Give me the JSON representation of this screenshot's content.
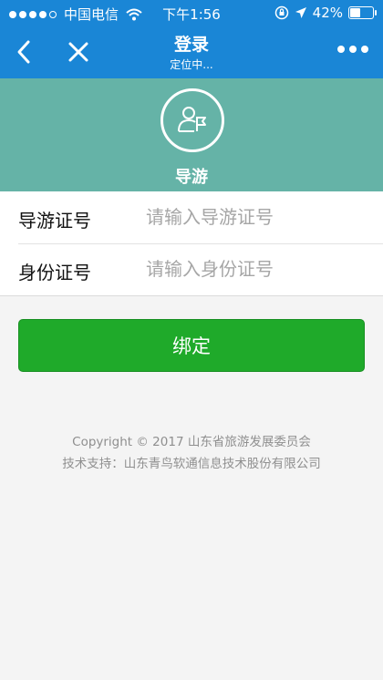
{
  "status": {
    "carrier": "中国电信",
    "time": "下午1:56",
    "battery": "42%",
    "battery_level": 0.42
  },
  "nav": {
    "title": "登录",
    "subtitle": "定位中...",
    "icons": [
      "chevron-left-icon",
      "close-icon",
      "more-dots-icon"
    ]
  },
  "profile": {
    "role_label": "导游",
    "icon": "user-flag-icon"
  },
  "form": {
    "fields": [
      {
        "label": "导游证号",
        "placeholder": "请输入导游证号",
        "value": ""
      },
      {
        "label": "身份证号",
        "placeholder": "请输入身份证号",
        "value": ""
      }
    ]
  },
  "actions": {
    "bind_label": "绑定"
  },
  "footer": {
    "copyright": "Copyright © 2017 山东省旅游发展委员会",
    "support": "技术支持：山东青鸟软通信息技术股份有限公司"
  },
  "colors": {
    "nav_bg": "#1a86d6",
    "profile_bg": "#65b3a7",
    "button_bg": "#1faa2a"
  }
}
